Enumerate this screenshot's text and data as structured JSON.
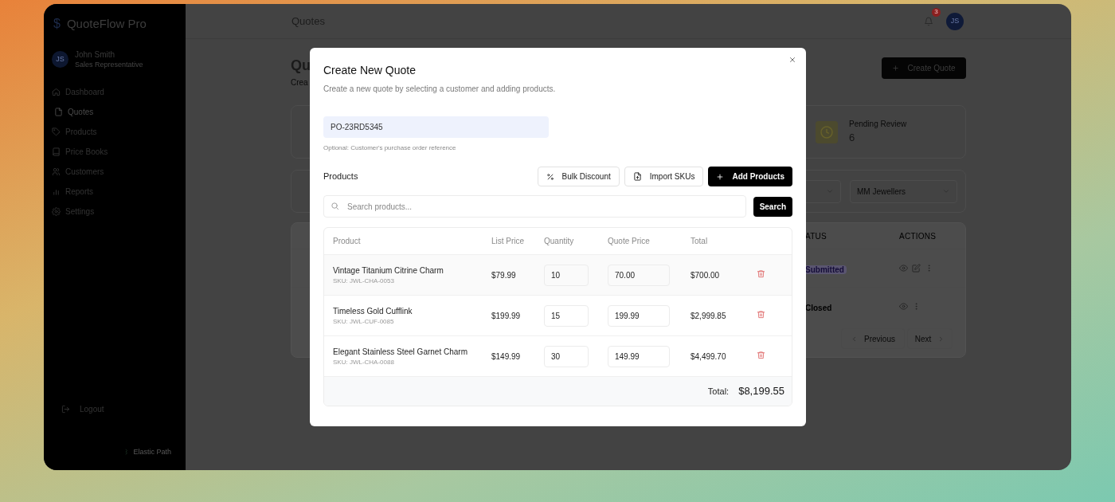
{
  "app": {
    "name": "QuoteFlow Pro",
    "logo_glyph": "$"
  },
  "user": {
    "initials": "JS",
    "name": "John Smith",
    "role": "Sales Representative"
  },
  "sidebar": {
    "items": [
      {
        "label": "Dashboard",
        "selected": false
      },
      {
        "label": "Quotes",
        "selected": true
      },
      {
        "label": "Products",
        "selected": false
      },
      {
        "label": "Price Books",
        "selected": false
      },
      {
        "label": "Customers",
        "selected": false
      },
      {
        "label": "Reports",
        "selected": false
      },
      {
        "label": "Settings",
        "selected": false
      }
    ],
    "logout": "Logout",
    "footer": "Elastic Path"
  },
  "header": {
    "title": "Quotes",
    "notification_count": "3",
    "avatar": "JS"
  },
  "page": {
    "title": "Qu",
    "subtitle": "Crea",
    "create_button": "Create Quote",
    "stat": {
      "label": "Pending Review",
      "value": "6"
    },
    "filters": [
      "MM Jewellers"
    ],
    "table_columns": [
      "ATUS",
      "ACTIONS"
    ],
    "rows": [
      {
        "status": "Submitted",
        "kind": "submitted",
        "editable": true
      },
      {
        "status": "Closed",
        "kind": "closed",
        "editable": false
      }
    ],
    "pagination": {
      "previous": "Previous",
      "next": "Next"
    }
  },
  "modal": {
    "title": "Create New Quote",
    "description": "Create a new quote by selecting a customer and adding products.",
    "po_field": {
      "value": "PO-23RD5345",
      "help": "Optional: Customer's purchase order reference"
    },
    "products_heading": "Products",
    "buttons": [
      {
        "label": "Bulk Discount",
        "kind": "outline"
      },
      {
        "label": "Import SKUs",
        "kind": "outline"
      },
      {
        "label": "Add Products",
        "kind": "primary"
      }
    ],
    "search": {
      "placeholder": "Search products...",
      "button": "Search"
    },
    "columns": [
      "Product",
      "List Price",
      "Quantity",
      "Quote Price",
      "Total"
    ],
    "rows": [
      {
        "name": "Vintage Titanium Citrine Charm",
        "sku": "SKU: JWL-CHA-0053",
        "list_price": "$79.99",
        "quantity": "10",
        "quote_price": "70.00",
        "total": "$700.00"
      },
      {
        "name": "Timeless Gold Cufflink",
        "sku": "SKU: JWL-CUF-0085",
        "list_price": "$199.99",
        "quantity": "15",
        "quote_price": "199.99",
        "total": "$2,999.85"
      },
      {
        "name": "Elegant Stainless Steel Garnet Charm",
        "sku": "SKU: JWL-CHA-0088",
        "list_price": "$149.99",
        "quantity": "30",
        "quote_price": "149.99",
        "total": "$4,499.70"
      }
    ],
    "total_label": "Total:",
    "total_value": "$8,199.55"
  }
}
